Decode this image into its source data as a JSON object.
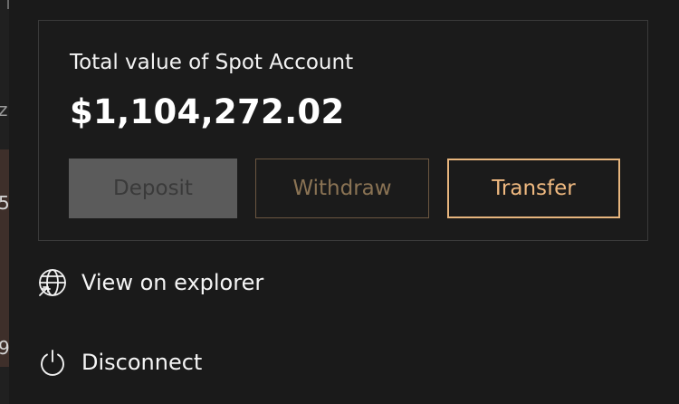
{
  "background": {
    "glyphs": [
      "z",
      "5",
      "9"
    ]
  },
  "account_card": {
    "label": "Total value of Spot Account",
    "value": "$1,104,272.02",
    "buttons": {
      "deposit": "Deposit",
      "withdraw": "Withdraw",
      "transfer": "Transfer"
    }
  },
  "menu": {
    "view_explorer": {
      "label": "View on explorer",
      "icon": "globe-link-icon"
    },
    "disconnect": {
      "label": "Disconnect",
      "icon": "power-icon"
    }
  },
  "colors": {
    "panel_bg": "#1a1a1a",
    "accent": "#efb980",
    "deposit_disabled_bg": "#5b5b5b",
    "withdraw_disabled_border": "#6b5640"
  }
}
